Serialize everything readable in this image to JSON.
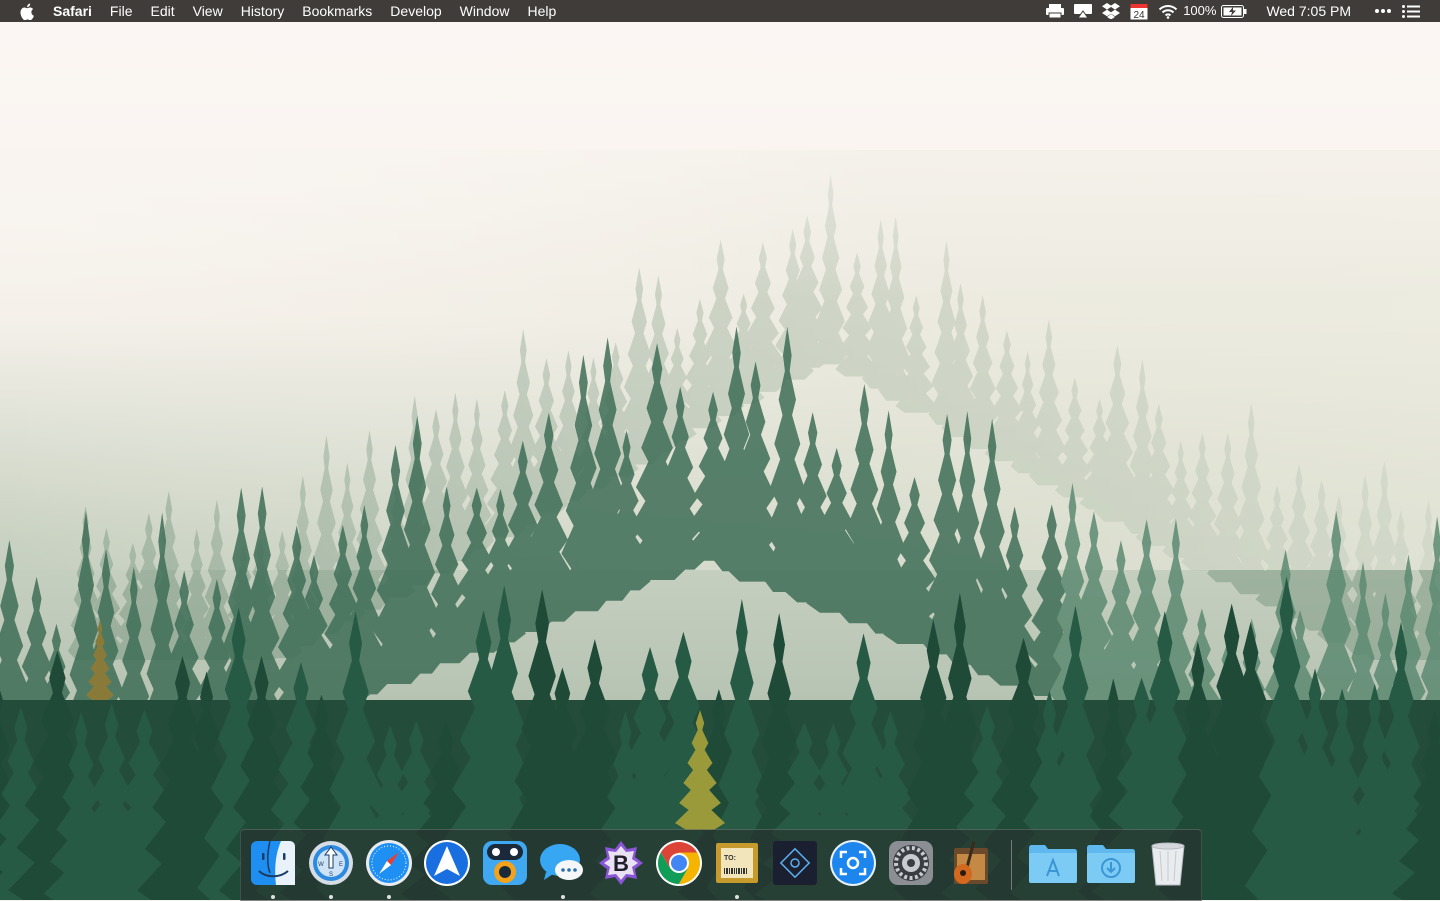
{
  "menubar": {
    "apple_icon": "apple-icon",
    "app_name": "Safari",
    "menus": [
      "File",
      "Edit",
      "View",
      "History",
      "Bookmarks",
      "Develop",
      "Window",
      "Help"
    ],
    "status": {
      "calendar_day": "24",
      "battery_percent": "100%",
      "clock": "Wed 7:05 PM"
    },
    "icons": [
      "printer-icon",
      "airplay-icon",
      "dropbox-icon",
      "calendar-icon",
      "wifi-icon",
      "battery-icon",
      "more-icon",
      "notification-center-icon"
    ]
  },
  "wallpaper": {
    "description_colors": {
      "sky": "#fbf5f1",
      "forest_dark": "#1f4a38",
      "forest_mid": "#3d6b50"
    }
  },
  "dock": {
    "apps": [
      {
        "name": "finder-icon",
        "running": true
      },
      {
        "name": "compass-app-icon",
        "running": true,
        "compass_letters": [
          "W",
          "N",
          "E",
          "S"
        ]
      },
      {
        "name": "safari-icon",
        "running": true
      },
      {
        "name": "spark-mail-icon",
        "running": false
      },
      {
        "name": "tweetbot-icon",
        "running": false
      },
      {
        "name": "messages-icon",
        "running": true
      },
      {
        "name": "bbedit-icon",
        "running": false,
        "letter": "B"
      },
      {
        "name": "chrome-icon",
        "running": false
      },
      {
        "name": "letter-app-icon",
        "running": true,
        "label": "TO:"
      },
      {
        "name": "photo-editor-icon",
        "running": false
      },
      {
        "name": "screenshot-app-icon",
        "running": false
      },
      {
        "name": "system-preferences-icon",
        "running": false
      },
      {
        "name": "garageband-icon",
        "running": false
      }
    ],
    "folders": [
      {
        "name": "applications-folder-icon"
      },
      {
        "name": "downloads-folder-icon"
      },
      {
        "name": "trash-icon"
      }
    ]
  }
}
